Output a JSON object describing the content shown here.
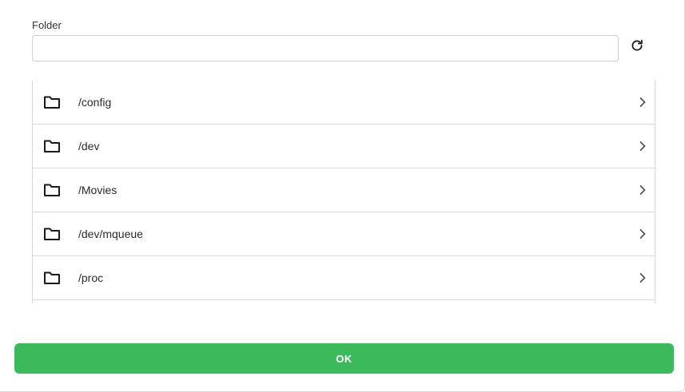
{
  "folder_field": {
    "label": "Folder",
    "value": "",
    "placeholder": ""
  },
  "folder_list": {
    "items": [
      {
        "label": "/config",
        "icon": "folder-icon"
      },
      {
        "label": "/dev",
        "icon": "folder-icon"
      },
      {
        "label": "/Movies",
        "icon": "folder-icon"
      },
      {
        "label": "/dev/mqueue",
        "icon": "folder-icon"
      },
      {
        "label": "/proc",
        "icon": "folder-icon"
      }
    ]
  },
  "actions": {
    "ok_label": "OK"
  },
  "colors": {
    "ok_button": "#3cb95a",
    "border": "#d6d6d6"
  }
}
